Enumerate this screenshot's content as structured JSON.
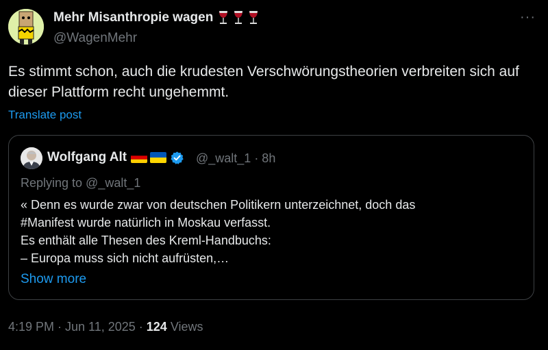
{
  "author": {
    "display_name": "Mehr Misanthropie wagen",
    "emoji_count": 3,
    "emoji_name": "wine-glass",
    "handle": "@WagenMehr",
    "avatar_bg": "#dff0a8"
  },
  "more_label": "···",
  "post": {
    "text": "Es stimmt schon, auch die krudesten Verschwörungstheorien verbreiten sich auf dieser Plattform recht ungehemmt.",
    "translate_label": "Translate post"
  },
  "quoted": {
    "name": "Wolfgang Alt",
    "flags": [
      "germany-flag",
      "ukraine-flag"
    ],
    "verified": true,
    "handle_time": "@_walt_1 · 8h",
    "replying_to": "Replying to @_walt_1",
    "text": "« Denn es wurde zwar von deutschen Politikern unterzeichnet, doch das\n#Manifest wurde natürlich in Moskau verfasst.\nEs enthält alle Thesen des Kreml-Handbuchs:\n– Europa muss sich nicht aufrüsten,…",
    "show_more": "Show more"
  },
  "footer": {
    "timestamp": "4:19 PM · Jun 11, 2025 · ",
    "views_count": "124",
    "views_label": " Views"
  },
  "colors": {
    "background": "#000000",
    "text": "#e7e9ea",
    "muted": "#71767b",
    "link": "#1d9bf0",
    "border": "#3e4144"
  }
}
